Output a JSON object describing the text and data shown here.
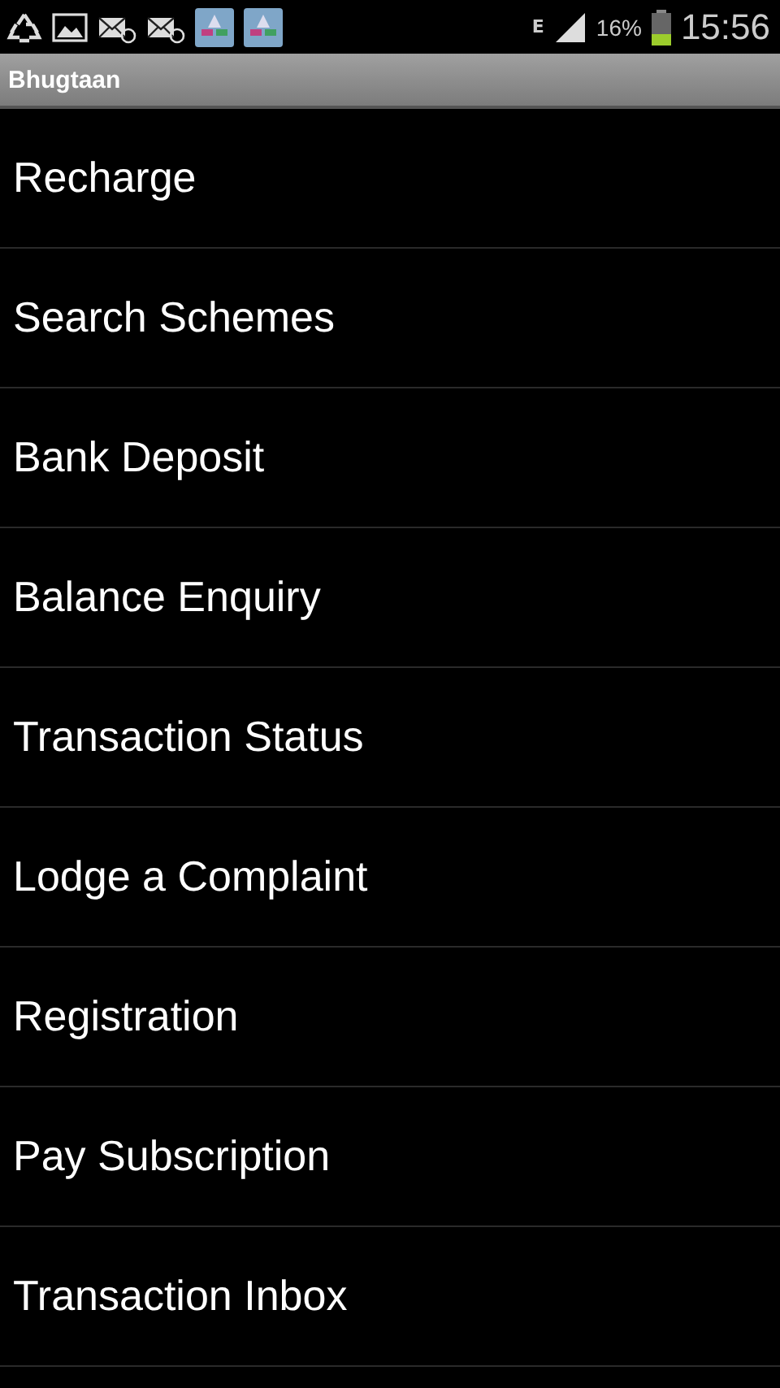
{
  "status_bar": {
    "network": "E",
    "battery": "16%",
    "time": "15:56"
  },
  "title_bar": {
    "title": "Bhugtaan"
  },
  "menu": [
    {
      "label": "Recharge"
    },
    {
      "label": "Search Schemes"
    },
    {
      "label": "Bank Deposit"
    },
    {
      "label": "Balance Enquiry"
    },
    {
      "label": "Transaction Status"
    },
    {
      "label": "Lodge a Complaint"
    },
    {
      "label": "Registration"
    },
    {
      "label": "Pay Subscription"
    },
    {
      "label": "Transaction Inbox"
    }
  ]
}
